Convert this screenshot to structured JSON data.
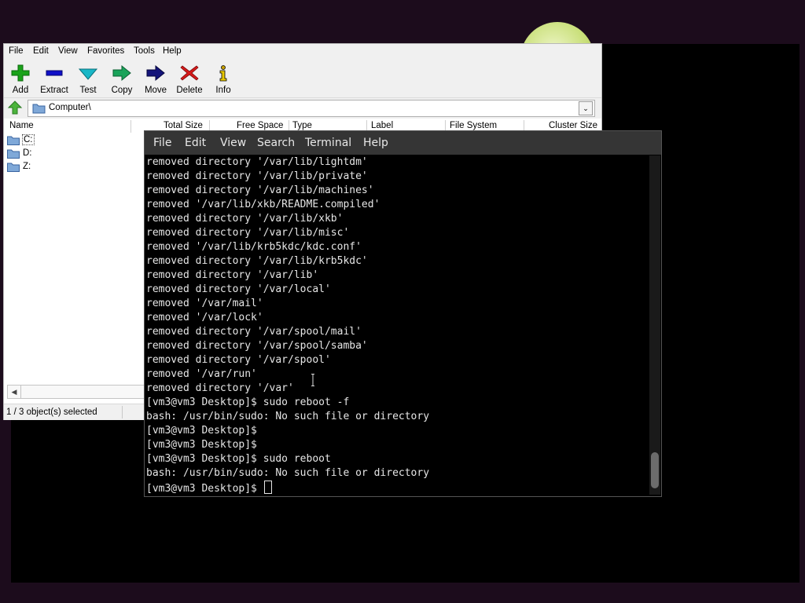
{
  "file_manager": {
    "menu": [
      "File",
      "Edit",
      "View",
      "Favorites",
      "Tools",
      "Help"
    ],
    "toolbar": [
      {
        "label": "Add",
        "icon": "plus-icon"
      },
      {
        "label": "Extract",
        "icon": "minus-icon"
      },
      {
        "label": "Test",
        "icon": "check-icon"
      },
      {
        "label": "Copy",
        "icon": "copy-arrow-icon"
      },
      {
        "label": "Move",
        "icon": "move-arrow-icon"
      },
      {
        "label": "Delete",
        "icon": "delete-x-icon"
      },
      {
        "label": "Info",
        "icon": "info-icon"
      }
    ],
    "address": "Computer\\",
    "columns": [
      "Name",
      "Total Size",
      "Free Space",
      "Type",
      "Label",
      "File System",
      "Cluster Size"
    ],
    "drives": [
      "C:",
      "D:",
      "Z:"
    ],
    "selected_drive": "C:",
    "status": "1 / 3 object(s) selected",
    "colors": {
      "add": "#1aa31a",
      "extract": "#1010c8",
      "test": "#19b7c7",
      "copy": "#1aa35a",
      "move": "#14147a",
      "delete": "#d61a1a",
      "info": "#c8a000"
    }
  },
  "terminal": {
    "menu": [
      "File",
      "Edit",
      "View",
      "Search",
      "Terminal",
      "Help"
    ],
    "lines": [
      "removed directory '/var/lib/lightdm'",
      "removed directory '/var/lib/private'",
      "removed directory '/var/lib/machines'",
      "removed '/var/lib/xkb/README.compiled'",
      "removed directory '/var/lib/xkb'",
      "removed directory '/var/lib/misc'",
      "removed '/var/lib/krb5kdc/kdc.conf'",
      "removed directory '/var/lib/krb5kdc'",
      "removed directory '/var/lib'",
      "removed directory '/var/local'",
      "removed '/var/mail'",
      "removed '/var/lock'",
      "removed directory '/var/spool/mail'",
      "removed directory '/var/spool/samba'",
      "removed directory '/var/spool'",
      "removed '/var/run'",
      "removed directory '/var'",
      "[vm3@vm3 Desktop]$ sudo reboot -f",
      "bash: /usr/bin/sudo: No such file or directory",
      "[vm3@vm3 Desktop]$",
      "[vm3@vm3 Desktop]$",
      "[vm3@vm3 Desktop]$ sudo reboot",
      "bash: /usr/bin/sudo: No such file or directory",
      "[vm3@vm3 Desktop]$ "
    ]
  }
}
